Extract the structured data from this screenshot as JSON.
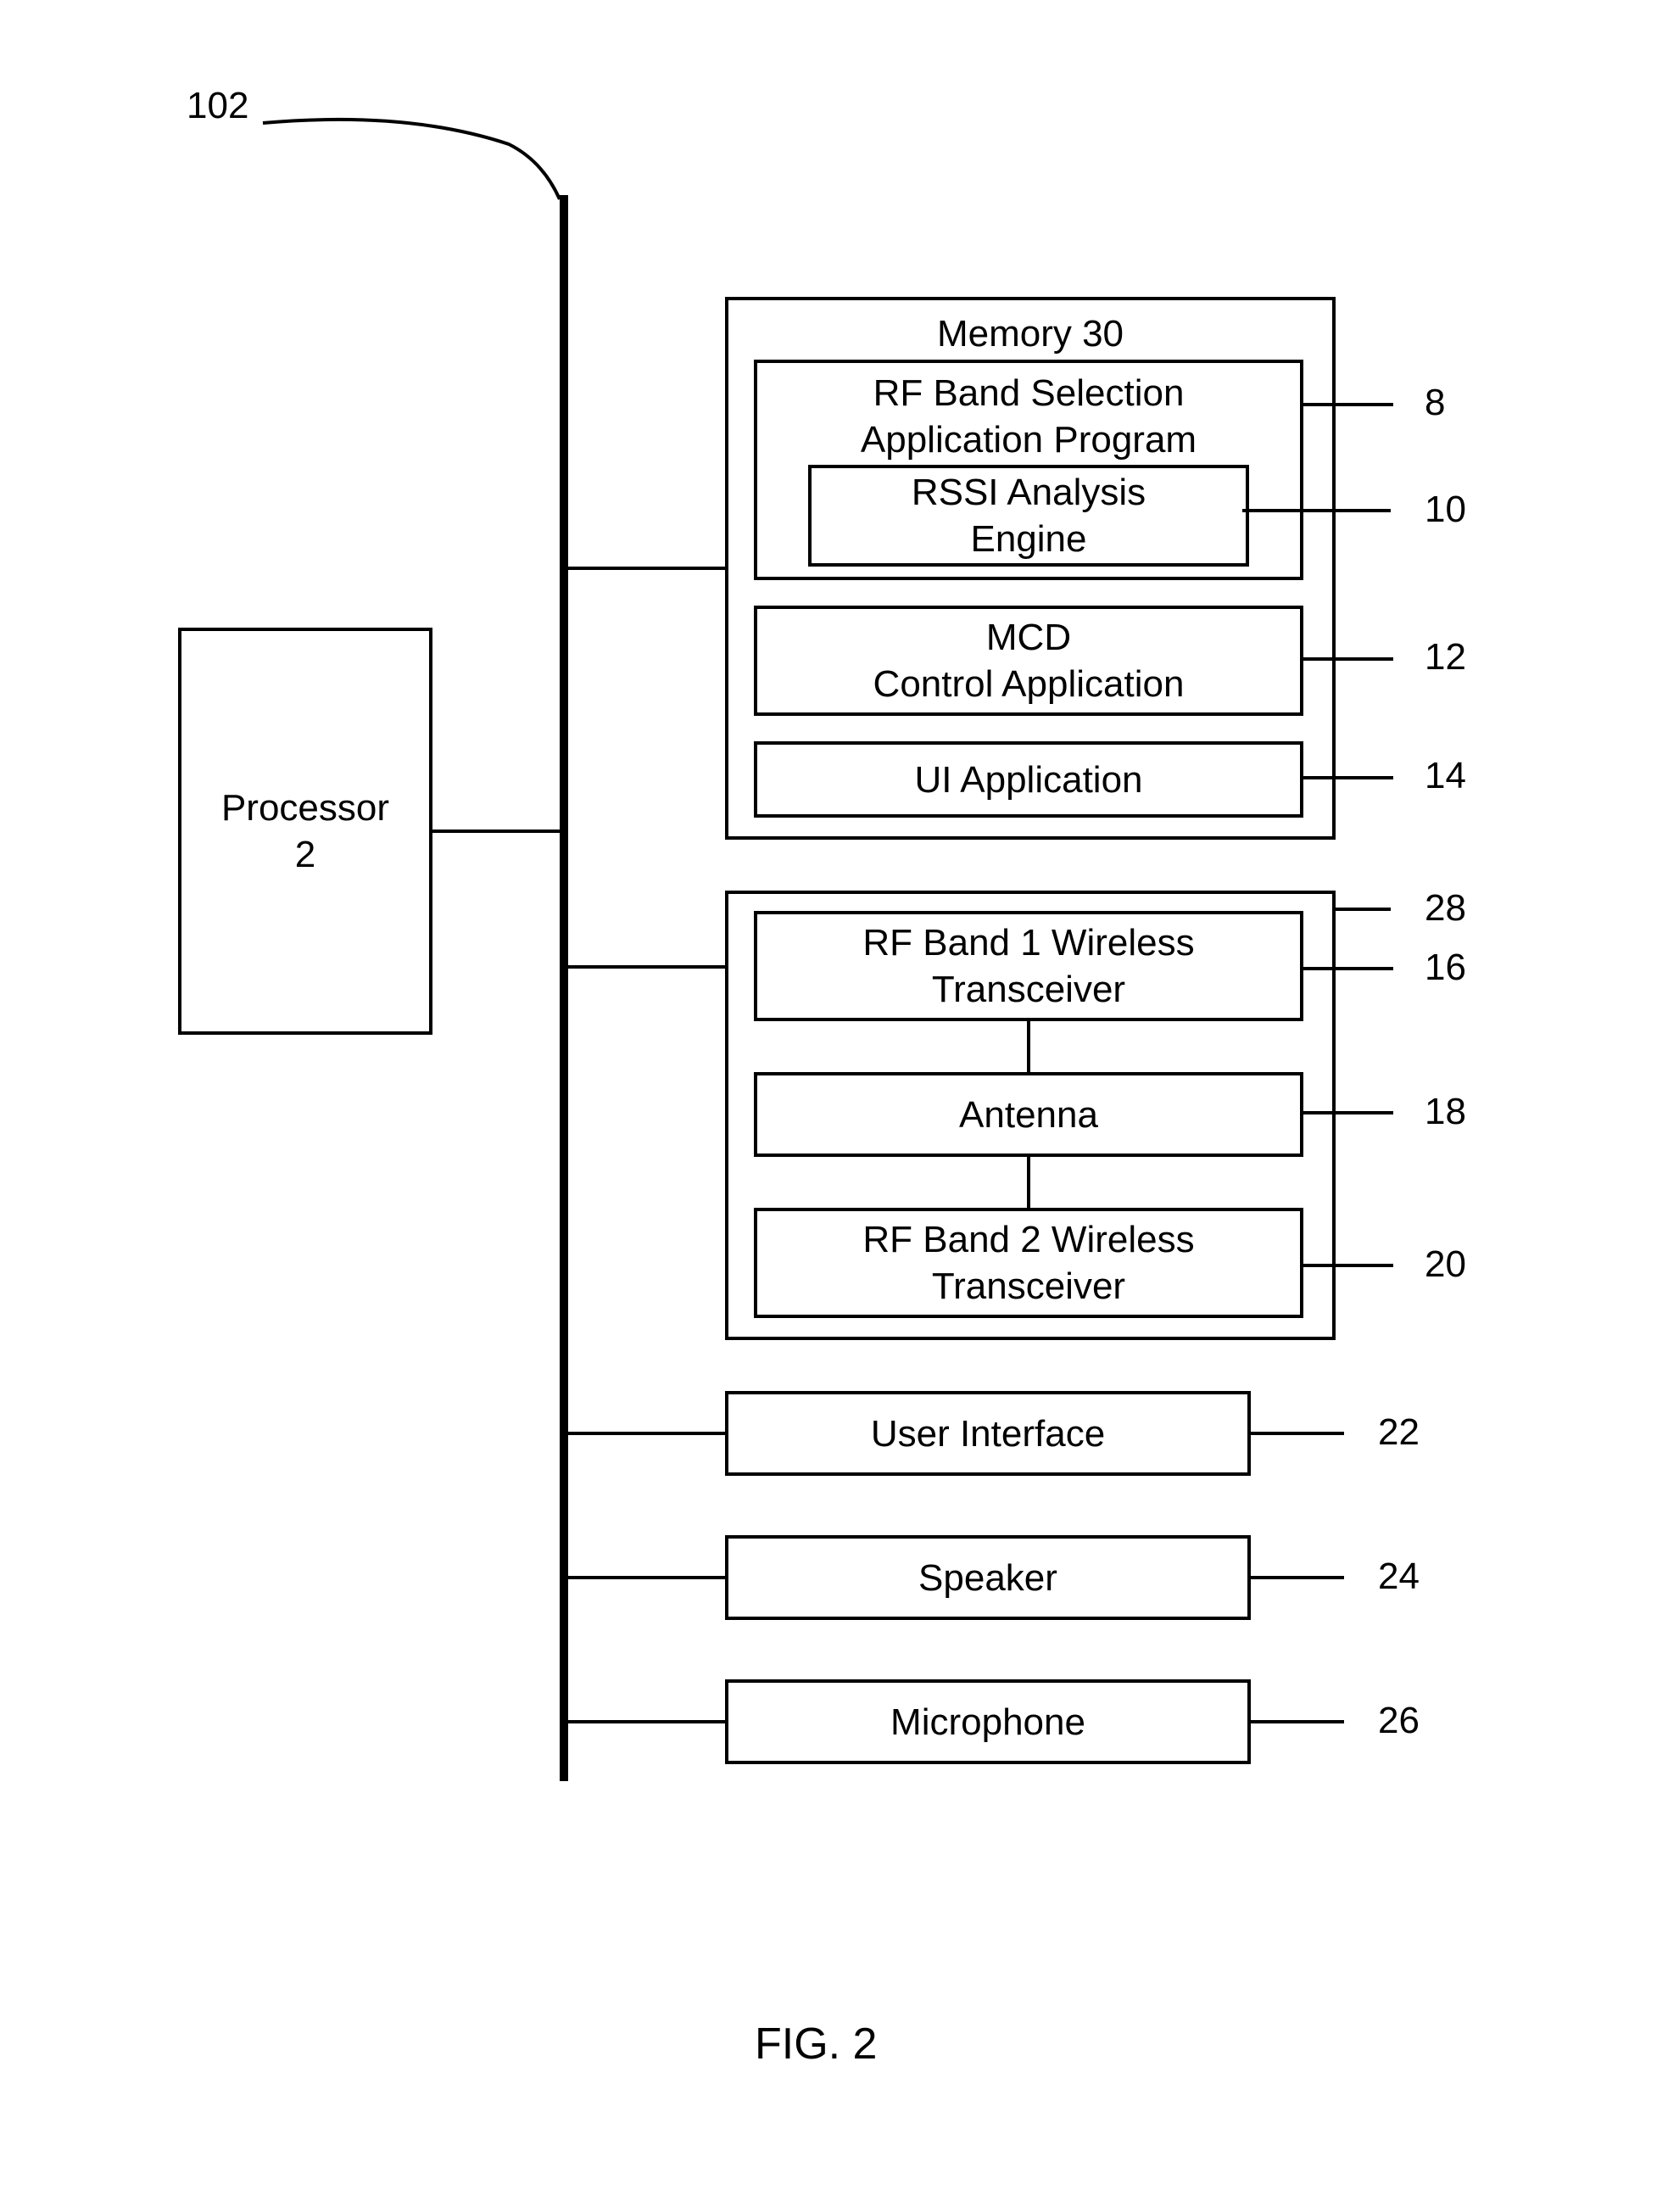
{
  "figure_ref": "102",
  "processor": {
    "label": "Processor\n2"
  },
  "memory": {
    "title": "Memory 30",
    "rf_band_selection": {
      "label": "RF Band Selection\nApplication Program",
      "ref": "8",
      "rssi": {
        "label": "RSSI Analysis\nEngine",
        "ref": "10"
      }
    },
    "mcd": {
      "label": "MCD\nControl Application",
      "ref": "12"
    },
    "ui_app": {
      "label": "UI Application",
      "ref": "14"
    }
  },
  "rf_block": {
    "ref": "28",
    "band1": {
      "label": "RF Band 1 Wireless\nTransceiver",
      "ref": "16"
    },
    "antenna": {
      "label": "Antenna",
      "ref": "18"
    },
    "band2": {
      "label": "RF Band 2 Wireless\nTransceiver",
      "ref": "20"
    }
  },
  "user_interface": {
    "label": "User Interface",
    "ref": "22"
  },
  "speaker": {
    "label": "Speaker",
    "ref": "24"
  },
  "microphone": {
    "label": "Microphone",
    "ref": "26"
  },
  "figure_label": "FIG. 2"
}
